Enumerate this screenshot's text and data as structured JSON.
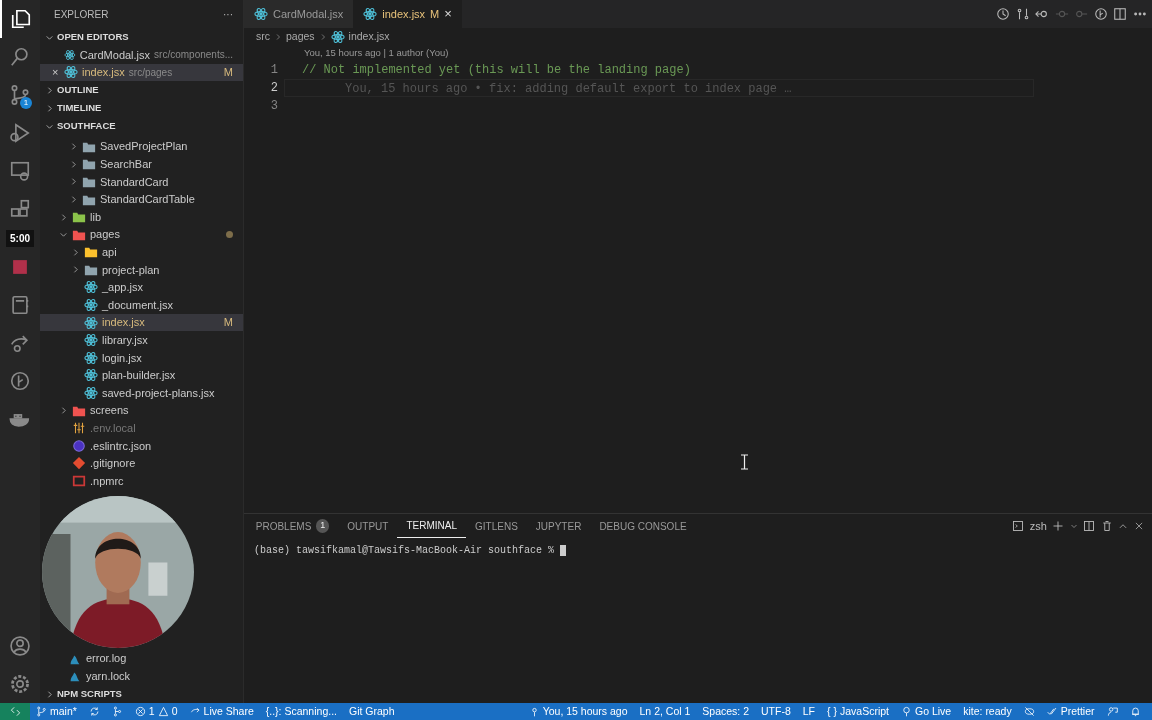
{
  "activity_bar": {
    "items": [
      {
        "kind": "files",
        "selected": true
      },
      {
        "kind": "search",
        "selected": false
      },
      {
        "kind": "source-control",
        "selected": false,
        "badge": "1"
      },
      {
        "kind": "debug",
        "selected": false
      },
      {
        "kind": "remote",
        "selected": false
      },
      {
        "kind": "extensions",
        "selected": false
      },
      {
        "kind": "timer",
        "selected": false,
        "label": "5:00"
      },
      {
        "kind": "record",
        "selected": false
      },
      {
        "kind": "notebook",
        "selected": false
      },
      {
        "kind": "share",
        "selected": false
      },
      {
        "kind": "graph",
        "selected": false
      },
      {
        "kind": "docker",
        "selected": false
      }
    ],
    "bottom": [
      {
        "kind": "account",
        "selected": false
      },
      {
        "kind": "settings",
        "selected": false
      }
    ]
  },
  "sidebar": {
    "title": "EXPLORER",
    "more": "···",
    "open_editors": {
      "title": "OPEN EDITORS",
      "expanded": true,
      "items": [
        {
          "label": "CardModal.jsx",
          "description": "src/components...",
          "kind": "react",
          "selected": false
        },
        {
          "label": "index.jsx",
          "description": "src/pages",
          "kind": "react",
          "selected": true,
          "badge": "M",
          "close": "×"
        }
      ]
    },
    "sections": [
      {
        "title": "OUTLINE",
        "expanded": false
      },
      {
        "title": "TIMELINE",
        "expanded": false
      }
    ],
    "workspace": {
      "title": "SOUTHFACE",
      "expanded": true,
      "scrolled_folders": [
        {
          "label": "SavedProjectPlan",
          "kind": "folder",
          "expanded": false,
          "selected": false
        },
        {
          "label": "SearchBar",
          "kind": "folder",
          "expanded": false,
          "selected": false
        },
        {
          "label": "StandardCard",
          "kind": "folder",
          "expanded": false,
          "selected": false
        },
        {
          "label": "StandardCardTable",
          "kind": "folder",
          "expanded": false,
          "selected": false
        }
      ],
      "tree": [
        {
          "label": "lib",
          "kind": "folder-lib",
          "expanded": false,
          "selected": false
        },
        {
          "label": "pages",
          "kind": "folder-pages",
          "expanded": true,
          "selected": false,
          "modified": true,
          "children": [
            {
              "label": "api",
              "kind": "folder-api",
              "expanded": false,
              "selected": false
            },
            {
              "label": "project-plan",
              "kind": "folder",
              "expanded": false,
              "selected": false
            },
            {
              "label": "_app.jsx",
              "kind": "react",
              "selected": false
            },
            {
              "label": "_document.jsx",
              "kind": "react",
              "selected": false
            },
            {
              "label": "index.jsx",
              "kind": "react",
              "selected": true,
              "badge": "M"
            },
            {
              "label": "library.jsx",
              "kind": "react",
              "selected": false
            },
            {
              "label": "login.jsx",
              "kind": "react",
              "selected": false
            },
            {
              "label": "plan-builder.jsx",
              "kind": "react",
              "selected": false
            },
            {
              "label": "saved-project-plans.jsx",
              "kind": "react",
              "selected": false
            }
          ]
        },
        {
          "label": "screens",
          "kind": "folder-pages",
          "expanded": false,
          "selected": false
        },
        {
          "label": ".env.local",
          "kind": "env",
          "selected": false,
          "ignored": true
        },
        {
          "label": ".eslintrc.json",
          "kind": "eslint",
          "selected": false
        },
        {
          "label": ".gitignore",
          "kind": "git",
          "selected": false
        },
        {
          "label": ".npmrc",
          "kind": "npm",
          "selected": false
        }
      ],
      "tree_after_overlay": [
        {
          "label": "error.log",
          "kind": "yarn",
          "selected": false
        },
        {
          "label": "yarn.lock",
          "kind": "yarn",
          "selected": false
        }
      ]
    },
    "bottom_sections": [
      {
        "title": "NPM SCRIPTS",
        "expanded": false
      }
    ]
  },
  "editor": {
    "tabs": [
      {
        "label": "CardModal.jsx",
        "selected": false
      },
      {
        "label": "index.jsx",
        "selected": true,
        "badge": "M",
        "close": "×"
      }
    ],
    "breadcrumb": [
      "src",
      "pages",
      "index.jsx"
    ],
    "codelens": "You, 15 hours ago | 1 author (You)",
    "lines": [
      {
        "number": "1",
        "text": "// Not implemented yet (this will be the landing page)",
        "current": false
      },
      {
        "number": "2",
        "current": true,
        "blame": "You, 15 hours ago • fix: adding default export to index page …"
      },
      {
        "number": "3",
        "current": false
      }
    ]
  },
  "panel": {
    "tabs": [
      {
        "label": "PROBLEMS",
        "badge": "1",
        "selected": false
      },
      {
        "label": "OUTPUT",
        "selected": false
      },
      {
        "label": "TERMINAL",
        "selected": true
      },
      {
        "label": "GITLENS",
        "selected": false
      },
      {
        "label": "JUPYTER",
        "selected": false
      },
      {
        "label": "DEBUG CONSOLE",
        "selected": false
      }
    ],
    "shell": "zsh",
    "terminal_line": "(base) tawsifkamal@Tawsifs-MacBook-Air southface % "
  },
  "status_bar": {
    "left": [
      {
        "kind": "remote"
      },
      {
        "kind": "branch",
        "text": "main*"
      },
      {
        "kind": "sync"
      },
      {
        "kind": "graph-icon"
      },
      {
        "kind": "problems",
        "errors": "1",
        "warnings": "0"
      },
      {
        "kind": "liveshare",
        "text": "Live Share"
      },
      {
        "kind": "text",
        "text": "{..}: Scanning..."
      },
      {
        "kind": "text",
        "text": "Git Graph"
      }
    ],
    "right": [
      {
        "kind": "blame",
        "text": "You, 15 hours ago"
      },
      {
        "kind": "text",
        "text": "Ln 2, Col 1"
      },
      {
        "kind": "text",
        "text": "Spaces: 2"
      },
      {
        "kind": "text",
        "text": "UTF-8"
      },
      {
        "kind": "text",
        "text": "LF"
      },
      {
        "kind": "language",
        "glyph": "{ }",
        "text": "JavaScript"
      },
      {
        "kind": "golive",
        "text": "Go Live"
      },
      {
        "kind": "text",
        "text": "kite: ready"
      },
      {
        "kind": "eye-off"
      },
      {
        "kind": "prettier",
        "text": "Prettier"
      },
      {
        "kind": "feedback"
      },
      {
        "kind": "bell"
      }
    ]
  }
}
